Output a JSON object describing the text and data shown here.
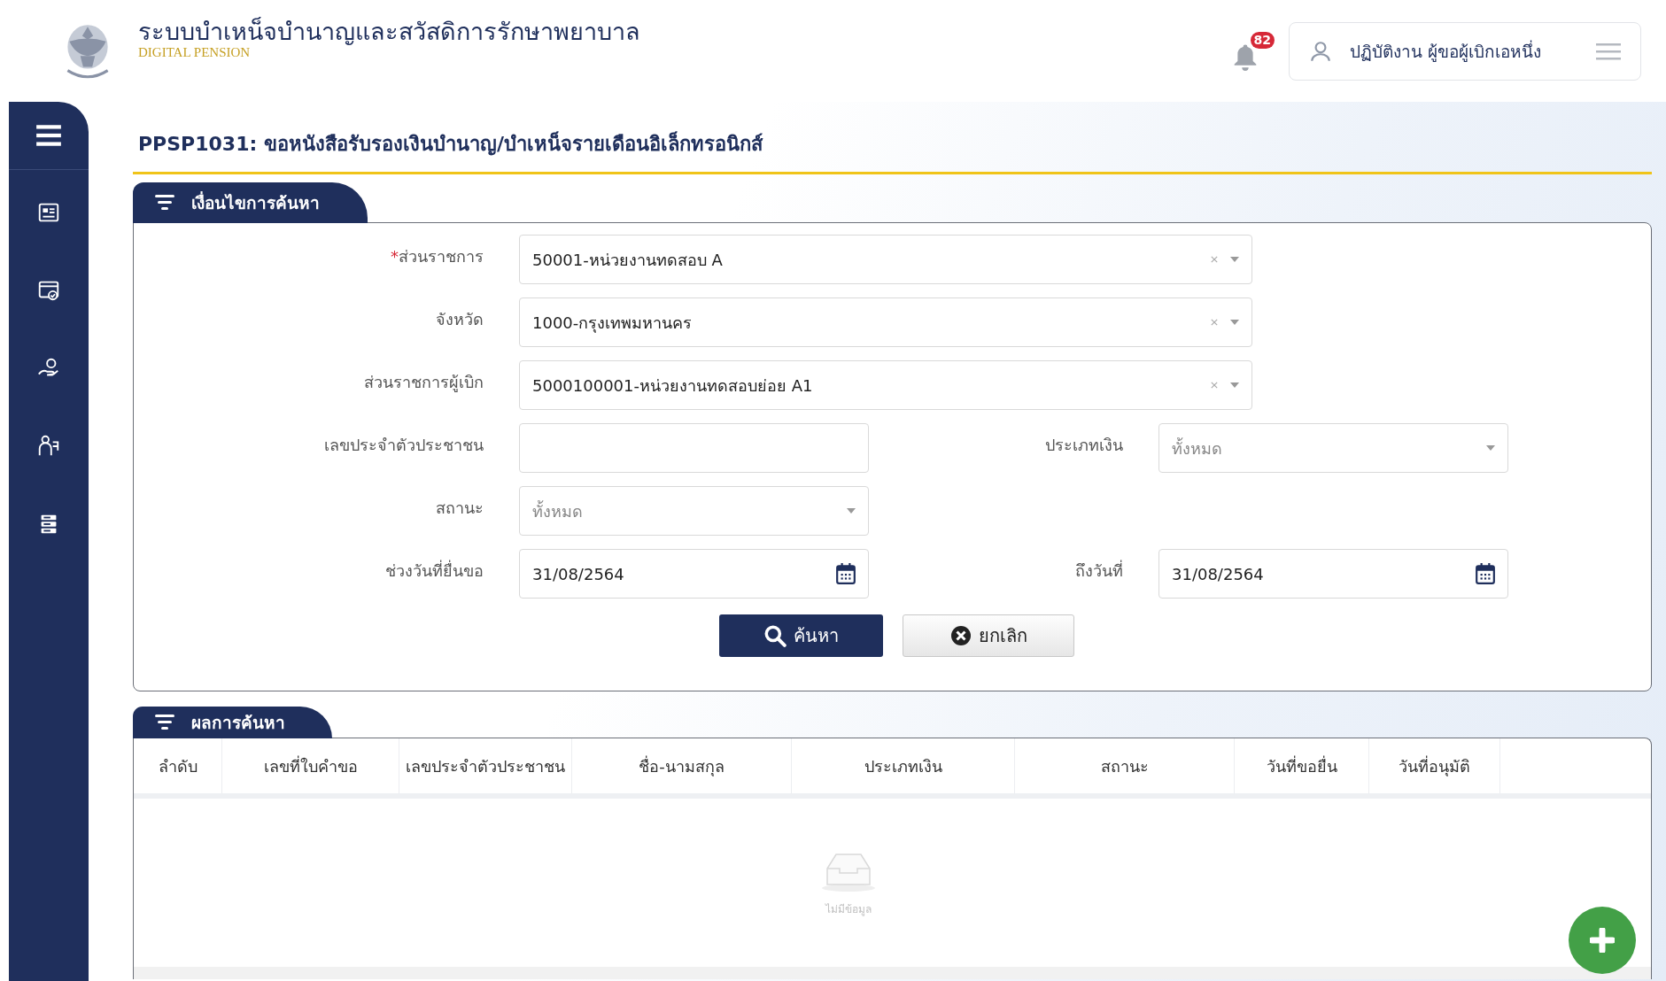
{
  "header": {
    "title": "ระบบบำเหน็จบำนาญและสวัสดิการรักษาพยาบาล",
    "subtitle": "DIGITAL PENSION",
    "notification_count": "82",
    "user": "ปฏิบัติงาน ผู้ขอผู้เบิกเอหนึ่ง"
  },
  "sidebar": {
    "items": [
      {
        "kind": "menu"
      },
      {
        "kind": "card"
      },
      {
        "kind": "check"
      },
      {
        "kind": "hand"
      },
      {
        "kind": "people"
      },
      {
        "kind": "server"
      }
    ]
  },
  "page_title": "PPSP1031: ขอหนังสือรับรองเงินบำนาญ/บำเหน็จรายเดือนอิเล็กทรอนิกส์",
  "search_panel": {
    "title": "เงื่อนไขการค้นหา",
    "rows": [
      {
        "fields": [
          {
            "kind": "combobox",
            "required_mark": "*",
            "label": "ส่วนราชการ",
            "value": "50001-หน่วยงานทดสอบ A"
          }
        ]
      },
      {
        "fields": [
          {
            "kind": "combobox",
            "label": "จังหวัด",
            "value": "1000-กรุงเทพมหานคร"
          }
        ]
      },
      {
        "fields": [
          {
            "kind": "combobox",
            "label": "ส่วนราชการผู้เบิก",
            "value": "5000100001-หน่วยงานทดสอบย่อย A1"
          }
        ]
      },
      {
        "fields": [
          {
            "kind": "text",
            "label": "เลขประจำตัวประชาชน"
          },
          {
            "kind": "select",
            "label": "ประเภทเงิน",
            "placeholder": "ทั้งหมด"
          }
        ]
      },
      {
        "fields": [
          {
            "kind": "select",
            "label": "สถานะ",
            "placeholder": "ทั้งหมด"
          }
        ]
      },
      {
        "fields": [
          {
            "kind": "date",
            "label": "ช่วงวันที่ยื่นขอ",
            "value": "31/08/2564"
          },
          {
            "kind": "date",
            "label": "ถึงวันที่",
            "value": "31/08/2564"
          }
        ]
      }
    ],
    "buttons": [
      {
        "kind": "primary",
        "label": "ค้นหา"
      },
      {
        "kind": "secondary",
        "label": "ยกเลิก"
      }
    ]
  },
  "results": {
    "title": "ผลการค้นหา",
    "columns": [
      "ลำดับ",
      "เลขที่ใบคำขอ",
      "เลขประจำตัวประชาชน",
      "ชื่อ-นามสกุล",
      "ประเภทเงิน",
      "สถานะ",
      "วันที่ขอยื่น",
      "วันที่อนุมัติ"
    ],
    "empty_text": "ไม่มีข้อมูล"
  }
}
